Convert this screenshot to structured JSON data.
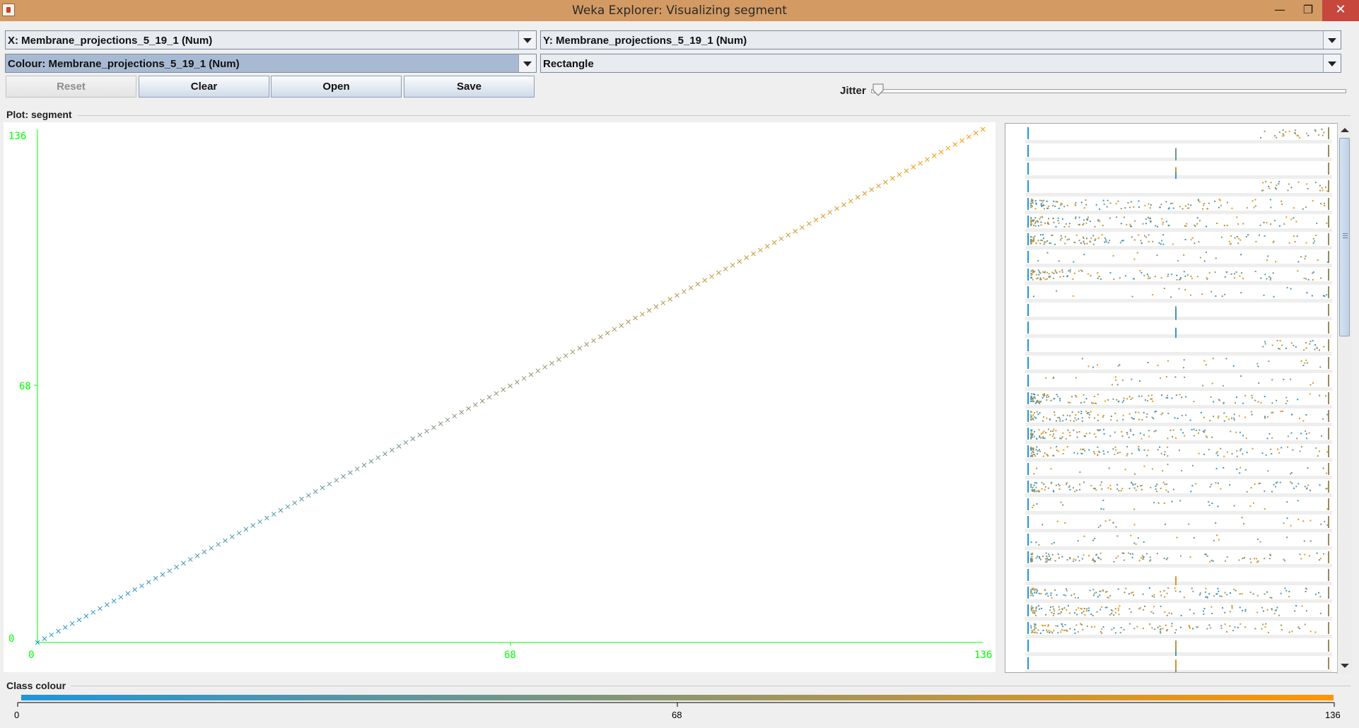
{
  "window": {
    "title": "Weka Explorer: Visualizing segment",
    "minimize_glyph": "—",
    "maximize_glyph": "❐",
    "close_glyph": "✕"
  },
  "controls": {
    "x_axis": "X: Membrane_projections_5_19_1 (Num)",
    "y_axis": "Y: Membrane_projections_5_19_1 (Num)",
    "colour": "Colour: Membrane_projections_5_19_1 (Num)",
    "shape": "Rectangle",
    "buttons": {
      "reset": "Reset",
      "clear": "Clear",
      "open": "Open",
      "save": "Save"
    },
    "jitter_label": "Jitter",
    "jitter_value": 0
  },
  "plot": {
    "group_label": "Plot: segment"
  },
  "class_colour": {
    "label": "Class colour",
    "min_label": "0",
    "mid_label": "68",
    "max_label": "136",
    "low_color": "#1e96dc",
    "high_color": "#ff9600"
  },
  "colors": {
    "axis": "#00ff00",
    "low": "#1e96dc",
    "high": "#ff9600"
  },
  "chart_data": {
    "type": "scatter",
    "marker": "x",
    "xlabel": "",
    "ylabel": "",
    "x_ticks": [
      "0",
      "68",
      "136"
    ],
    "y_ticks": [
      "0",
      "68",
      "136"
    ],
    "xlim": [
      0,
      136
    ],
    "ylim": [
      0,
      136
    ],
    "series": [
      {
        "x_start": 0,
        "x_end": 136,
        "relation": "y = x",
        "color_by": "value"
      }
    ]
  }
}
